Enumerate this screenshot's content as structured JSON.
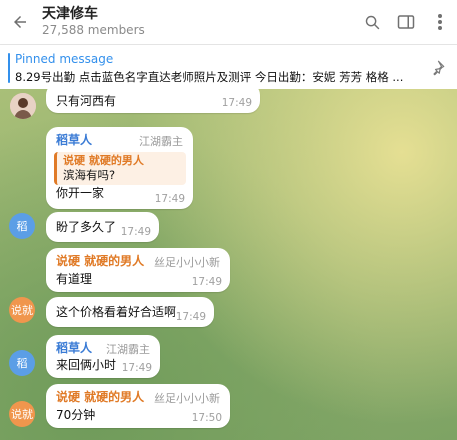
{
  "header": {
    "title": "天津修车",
    "subtitle": "27,588 members"
  },
  "pinned": {
    "label": "Pinned message",
    "text": "8.29号出勤  点击蓝色名字直达老师照片及测评  今日出勤：安妮 芳芳  格格 ..."
  },
  "messages": [
    {
      "id": "m0",
      "text": "只有河西有",
      "time": "17:49"
    },
    {
      "id": "m1",
      "sender": "稻草人",
      "rank": "江湖霸主",
      "quote_sender": "说硬 就硬的男人",
      "quote_text": "滨海有吗?",
      "text": "你开一家",
      "time": "17:49",
      "avatar": "稻"
    },
    {
      "id": "m2",
      "text": "盼了多久了",
      "time": "17:49"
    },
    {
      "id": "m3",
      "sender": "说硬 就硬的男人",
      "rank": "丝足小小小新",
      "text": "有道理",
      "time": "17:49",
      "avatar": "说就"
    },
    {
      "id": "m4",
      "text": "这个价格看着好合适啊",
      "time": "17:49"
    },
    {
      "id": "m5",
      "sender": "稻草人",
      "rank": "江湖霸主",
      "text": "来回俩小时",
      "time": "17:49",
      "avatar": "稻"
    },
    {
      "id": "m6",
      "sender": "说硬 就硬的男人",
      "rank": "丝足小小小新",
      "text": "70分钟",
      "time": "17:50",
      "avatar": "说就"
    }
  ],
  "colors": {
    "accent": "#3390ec",
    "sender_blue": "#3a7bd5",
    "sender_orange": "#e07a26"
  }
}
